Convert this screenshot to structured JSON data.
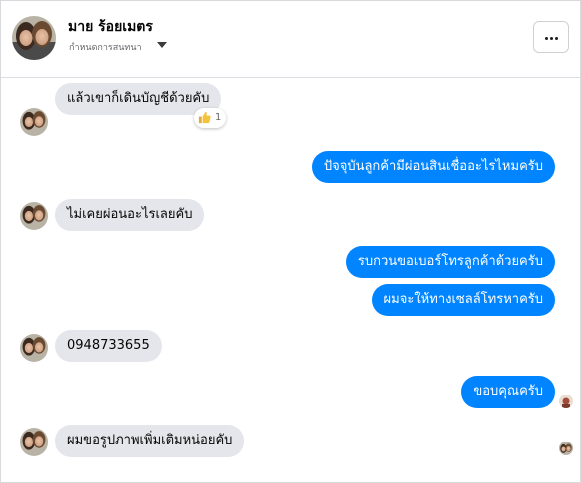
{
  "header": {
    "contact_name": "มาย ร้อยเมตร",
    "subtitle": "กำหนดการสนทนา",
    "more_icon": "more-dots-icon"
  },
  "colors": {
    "outgoing_bubble": "#0084ff",
    "incoming_bubble": "#e4e6eb",
    "secondary_text": "#65676b"
  },
  "messages": [
    {
      "direction": "incoming",
      "text": "แล้วเขาก็เดินบัญชีด้วยคับ",
      "reaction": {
        "icon": "thumbs-up-icon",
        "count": "1"
      }
    },
    {
      "direction": "outgoing",
      "text": "ปัจจุบันลูกค้ามีผ่อนสินเชื่ออะไรไหมครับ"
    },
    {
      "direction": "incoming",
      "text": "ไม่เคยผ่อนอะไรเลยคับ"
    },
    {
      "direction": "outgoing",
      "text": "รบกวนขอเบอร์โทรลูกค้าด้วยครับ"
    },
    {
      "direction": "outgoing",
      "text": "ผมจะให้ทางเซลล์โทรหาครับ"
    },
    {
      "direction": "incoming",
      "text": "0948733655"
    },
    {
      "direction": "outgoing",
      "text": "ขอบคุณครับ"
    },
    {
      "direction": "incoming",
      "text": "ผมขอรูปภาพเพิ่มเติมหน่อยคับ"
    }
  ]
}
